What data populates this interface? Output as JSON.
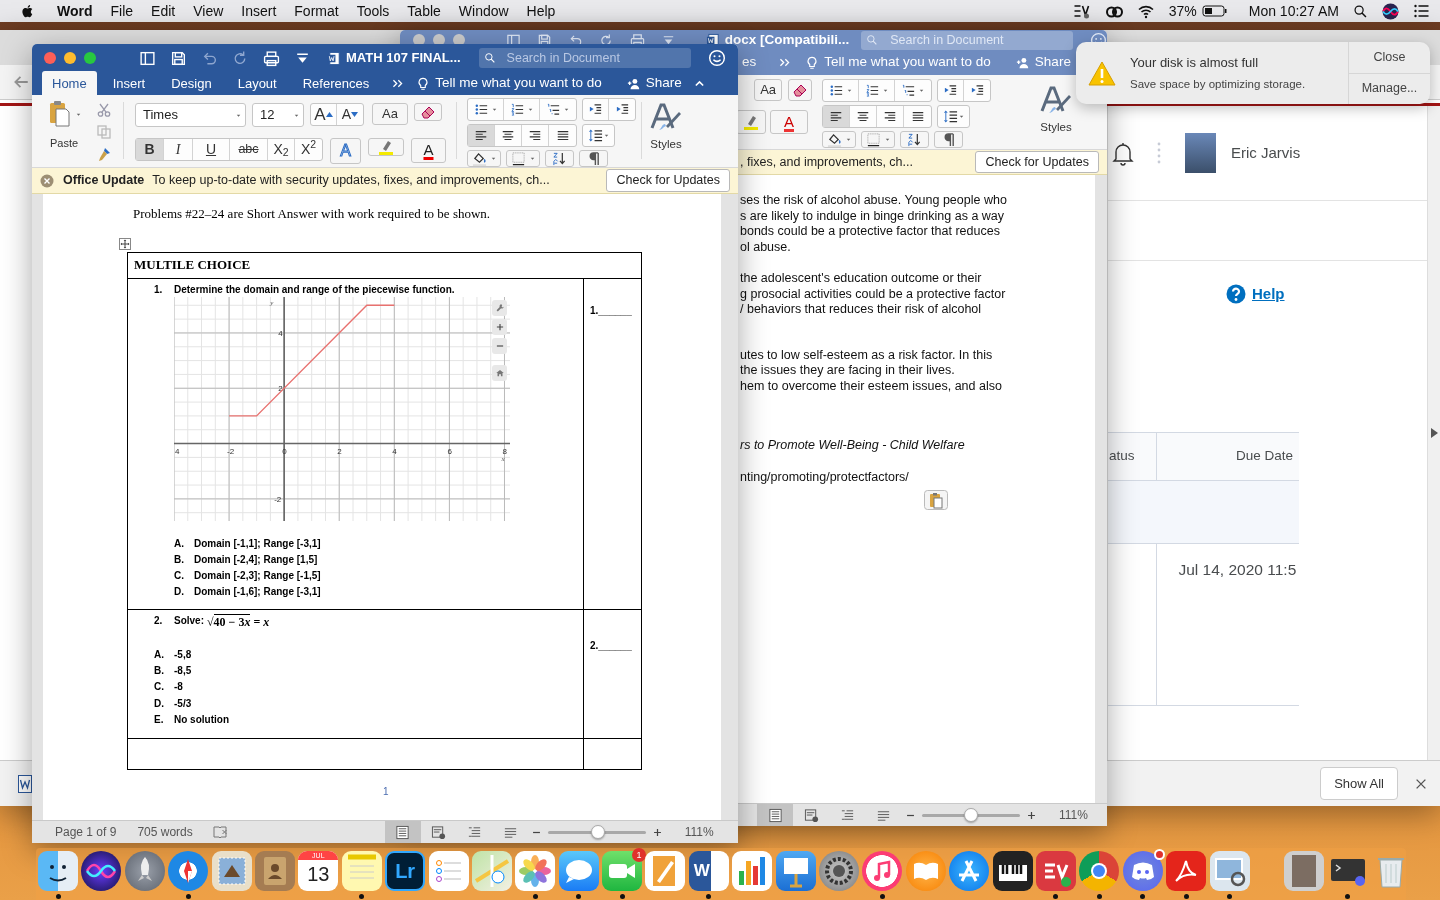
{
  "menu_bar": {
    "app": "Word",
    "menus": [
      "File",
      "Edit",
      "View",
      "Insert",
      "Format",
      "Tools",
      "Table",
      "Window",
      "Help"
    ],
    "battery": "37%",
    "clock": "Mon 10:27 AM"
  },
  "browser": {
    "user": "Eric Jarvis",
    "help": "Help",
    "table": {
      "columns": [
        "atus",
        "Due Date"
      ],
      "rows": [
        {
          "due_date": "Jul 14, 2020 11:5"
        }
      ]
    },
    "download_bar": {
      "button": "Show All"
    }
  },
  "back_window": {
    "focused": false,
    "title": "docx [Compatibili...",
    "search_placeholder": "Search in Document",
    "tab_fragment": "es",
    "tell_me": "Tell me what you want to do",
    "share": "Share",
    "case_button": "Aa",
    "font_color": "A",
    "align_buttons": [
      {
        "selected": true
      },
      {
        "selected": false
      },
      {
        "selected": false
      },
      {
        "selected": false
      }
    ],
    "styles": "Styles",
    "update_message": ", fixes, and improvements, ch...",
    "update_button": "Check for Updates",
    "paragraphs": [
      {
        "italic": false,
        "lines": [
          "ses the risk of alcohol abuse. Young people who",
          "s are likely to indulge in binge drinking as a way",
          "bonds could be a protective factor that reduces",
          "ol abuse."
        ]
      },
      {
        "italic": false,
        "lines": [
          "the adolescent's education outcome or their",
          "g prosocial activities could be a protective factor",
          "/ behaviors that reduces their risk of alcohol"
        ]
      },
      {
        "italic": false,
        "lines": [
          "utes to low self-esteem as a risk factor. In this",
          "the issues they are facing in their lives.",
          "hem to overcome their esteem issues, and also"
        ]
      },
      {
        "italic": true,
        "lines": [
          "rs to Promote Well-Being - Child Welfare"
        ]
      },
      {
        "italic": false,
        "lines": [
          "nting/promoting/protectfactors/"
        ]
      }
    ],
    "views": [
      {
        "selected": true
      },
      {
        "selected": false
      },
      {
        "selected": false
      },
      {
        "selected": false
      }
    ],
    "zoom": "111%",
    "level": 0.5
  },
  "front_window": {
    "focused": true,
    "title": "MATH 107 FINAL...",
    "search_placeholder": "Search in Document",
    "tabs": [
      {
        "label": "Home",
        "selected": true
      },
      {
        "label": "Insert",
        "selected": false
      },
      {
        "label": "Design",
        "selected": false
      },
      {
        "label": "Layout",
        "selected": false
      },
      {
        "label": "References",
        "selected": false
      }
    ],
    "tell_me": "Tell me what you want to do",
    "share": "Share",
    "paste": "Paste",
    "font": "Times",
    "size": "12",
    "size_buttons": [
      "A",
      "A"
    ],
    "case_button": "Aa",
    "format_buttons": [
      {
        "label": "B",
        "selected": true
      },
      {
        "label": "I",
        "selected": false
      },
      {
        "label": "U",
        "selected": false
      },
      {
        "label": "abc",
        "selected": false
      },
      {
        "label": "X$_{2}$",
        "selected": false
      },
      {
        "label": "X$^{2}$",
        "selected": false
      }
    ],
    "text_effects": "A",
    "font_color": "A",
    "align_buttons": [
      {
        "selected": true
      },
      {
        "selected": false
      },
      {
        "selected": false
      },
      {
        "selected": false
      }
    ],
    "styles": "Styles",
    "update": {
      "title": "Office Update",
      "message": "To keep up-to-date with security updates, fixes, and improvements, ch...",
      "button": "Check for Updates"
    },
    "document": {
      "intro": "Problems #22–24 are Short Answer with work required to be shown.",
      "table_heading": "MULTILE CHOICE",
      "questions": [
        {
          "number": "1.",
          "prompt": "Determine the domain and range of the piecewise function.",
          "answer": "1.______",
          "chart_data": {
            "type": "line",
            "grid": true,
            "xlabel": "x",
            "ylabel": "y",
            "x": [
              -2,
              -1,
              3,
              4
            ],
            "series": [
              {
                "color": "#e8716f",
                "values": [
                  1,
                  1,
                  5,
                  5
                ]
              }
            ],
            "xlim": [
              -4,
              8.2
            ],
            "ylim": [
              -2.8,
              5.3
            ],
            "xticks": [
              {
                "value": -4,
                "label": "4"
              },
              -2,
              0,
              2,
              4,
              6,
              8
            ],
            "yticks": [
              -2,
              2,
              4
            ]
          },
          "choices": [
            {
              "letter": "A.",
              "text": "Domain [-1,1]; Range [-3,1]"
            },
            {
              "letter": "B.",
              "text": "Domain [-2,4]; Range [1,5]"
            },
            {
              "letter": "C.",
              "text": "Domain [-2,3]; Range [-1,5]"
            },
            {
              "letter": "D.",
              "text": "Domain [-1,6]; Range [-3,1]"
            }
          ]
        },
        {
          "number": "2.",
          "prompt": "Solve:",
          "equation": {
            "radical": "√",
            "radicand": {
              "text": "40 − 3",
              "variable": "x"
            },
            "rhs": "= *x*"
          },
          "answer": "2.______",
          "choices": [
            {
              "letter": "A.",
              "text": "-5,8"
            },
            {
              "letter": "B.",
              "text": "-8,5"
            },
            {
              "letter": "C.",
              "text": "-8"
            },
            {
              "letter": "D.",
              "text": "-5/3"
            },
            {
              "letter": "E.",
              "text": "No solution"
            }
          ]
        }
      ],
      "page_number": "1"
    },
    "status": {
      "page": "Page 1 of 9",
      "words": "705 words",
      "views": [
        {
          "selected": true
        },
        {
          "selected": false
        },
        {
          "selected": false
        },
        {
          "selected": false
        }
      ],
      "zoom": "111%",
      "level": 0.51
    }
  },
  "notification": {
    "title": "Your disk is almost full",
    "message": "Save space by optimizing storage.",
    "buttons": [
      "Close",
      "Manage..."
    ]
  },
  "dock": {
    "items": [
      {
        "kind": "finder",
        "running": true
      },
      {
        "kind": "siri",
        "running": false
      },
      {
        "kind": "launchpad",
        "running": false
      },
      {
        "kind": "safari",
        "running": true
      },
      {
        "kind": "stamp",
        "running": false
      },
      {
        "kind": "contacts",
        "running": false
      },
      {
        "kind": "calendar",
        "running": false,
        "month": "JUL",
        "day": "13"
      },
      {
        "kind": "notes",
        "running": true
      },
      {
        "kind": "lettered",
        "running": false,
        "text": "Lr"
      },
      {
        "kind": "reminders",
        "running": false
      },
      {
        "kind": "maps",
        "running": false
      },
      {
        "kind": "photos",
        "running": true
      },
      {
        "kind": "messages",
        "running": true
      },
      {
        "kind": "facetime",
        "running": true,
        "badge": "1"
      },
      {
        "kind": "pages",
        "running": false
      },
      {
        "kind": "word",
        "running": true,
        "text": "W"
      },
      {
        "kind": "numbers",
        "running": false
      },
      {
        "kind": "keynote",
        "running": false
      },
      {
        "kind": "preferences",
        "running": false
      },
      {
        "kind": "music",
        "running": true
      },
      {
        "kind": "books",
        "running": false
      },
      {
        "kind": "appstore",
        "running": false
      },
      {
        "kind": "piano",
        "running": false
      },
      {
        "kind": "vpn",
        "running": true
      },
      {
        "kind": "chrome",
        "running": true
      },
      {
        "kind": "discord",
        "running": true,
        "dot": true
      },
      {
        "kind": "acrobat",
        "running": true
      },
      {
        "kind": "preview",
        "running": true
      },
      {
        "kind": "separator"
      },
      {
        "kind": "photo",
        "running": false
      },
      {
        "kind": "terminal",
        "running": true
      },
      {
        "kind": "trash",
        "running": false
      }
    ]
  }
}
